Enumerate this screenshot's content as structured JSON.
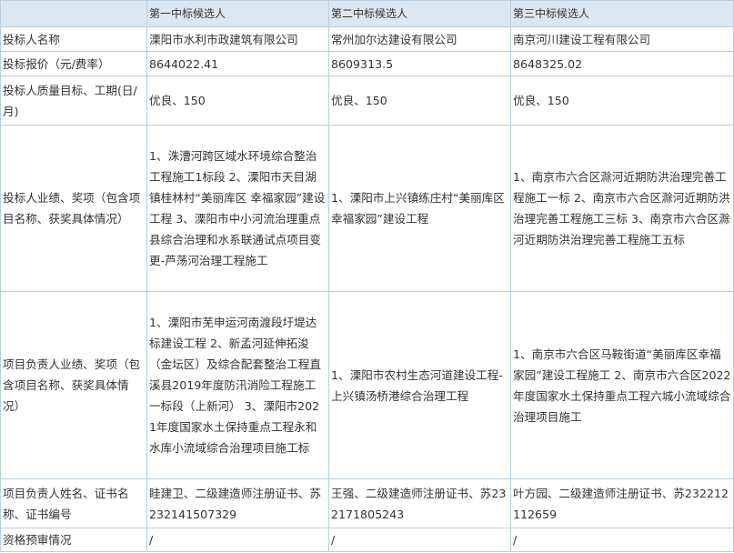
{
  "header": {
    "corner": "",
    "candidates": [
      "第一中标候选人",
      "第二中标候选人",
      "第三中标候选人"
    ]
  },
  "rows": [
    {
      "label": "投标人名称",
      "values": [
        "溧阳市水利市政建筑有限公司",
        "常州加尔达建设有限公司",
        "南京河川建设工程有限公司"
      ]
    },
    {
      "label": "投标报价（元/费率）",
      "values": [
        "8644022.41",
        "8609313.5",
        "8648325.02"
      ]
    },
    {
      "label": "投标人质量目标、工期(日/月)",
      "values": [
        "优良、150",
        "优良、150",
        "优良、150"
      ]
    },
    {
      "label": "投标人业绩、奖项（包含项目名称、获奖具体情况）",
      "values": [
        "1、洙漕河跨区域水环境综合整治工程施工1标段 2、溧阳市天目湖镇桂林村“美丽库区 幸福家园”建设工程 3、溧阳市中小河流治理重点县综合治理和水系联通试点项目变更-芦荡河治理工程施工",
        "1、溧阳市上兴镇练庄村“美丽库区幸福家园”建设工程",
        "1、南京市六合区滁河近期防洪治理完善工程施工一标 2、南京市六合区滁河近期防洪治理完善工程施工三标 3、南京市六合区滁河近期防洪治理完善工程施工五标"
      ]
    },
    {
      "label": "项目负责人业绩、奖项（包含项目名称、获奖具体情况）",
      "values": [
        "1、溧阳市芜申运河南渡段圩堤达标建设工程 2、新孟河延伸拓浚（金坛区）及综合配套整治工程直溪县2019年度防汛消险工程施工一标段（上新河） 3、溧阳市2021年度国家水土保持重点工程永和水库小流域综合治理项目施工标",
        "1、溧阳市农村生态河道建设工程-上兴镇汤桥港综合治理工程",
        "1、南京市六合区马鞍街道“美丽库区幸福家园”建设工程施工 2、南京市六合区2022年度国家水土保持重点工程六城小流域综合治理项目施工"
      ]
    },
    {
      "label": "项目负责人姓名、证书名称、证书编号",
      "values": [
        "眭建卫、二级建造师注册证书、苏232141507329",
        "王强、二级建造师注册证书、苏232171805243",
        "叶方园、二级建造师注册证书、苏232212112659"
      ]
    },
    {
      "label": "资格预审情况",
      "values": [
        "/",
        "/",
        "/"
      ]
    }
  ]
}
